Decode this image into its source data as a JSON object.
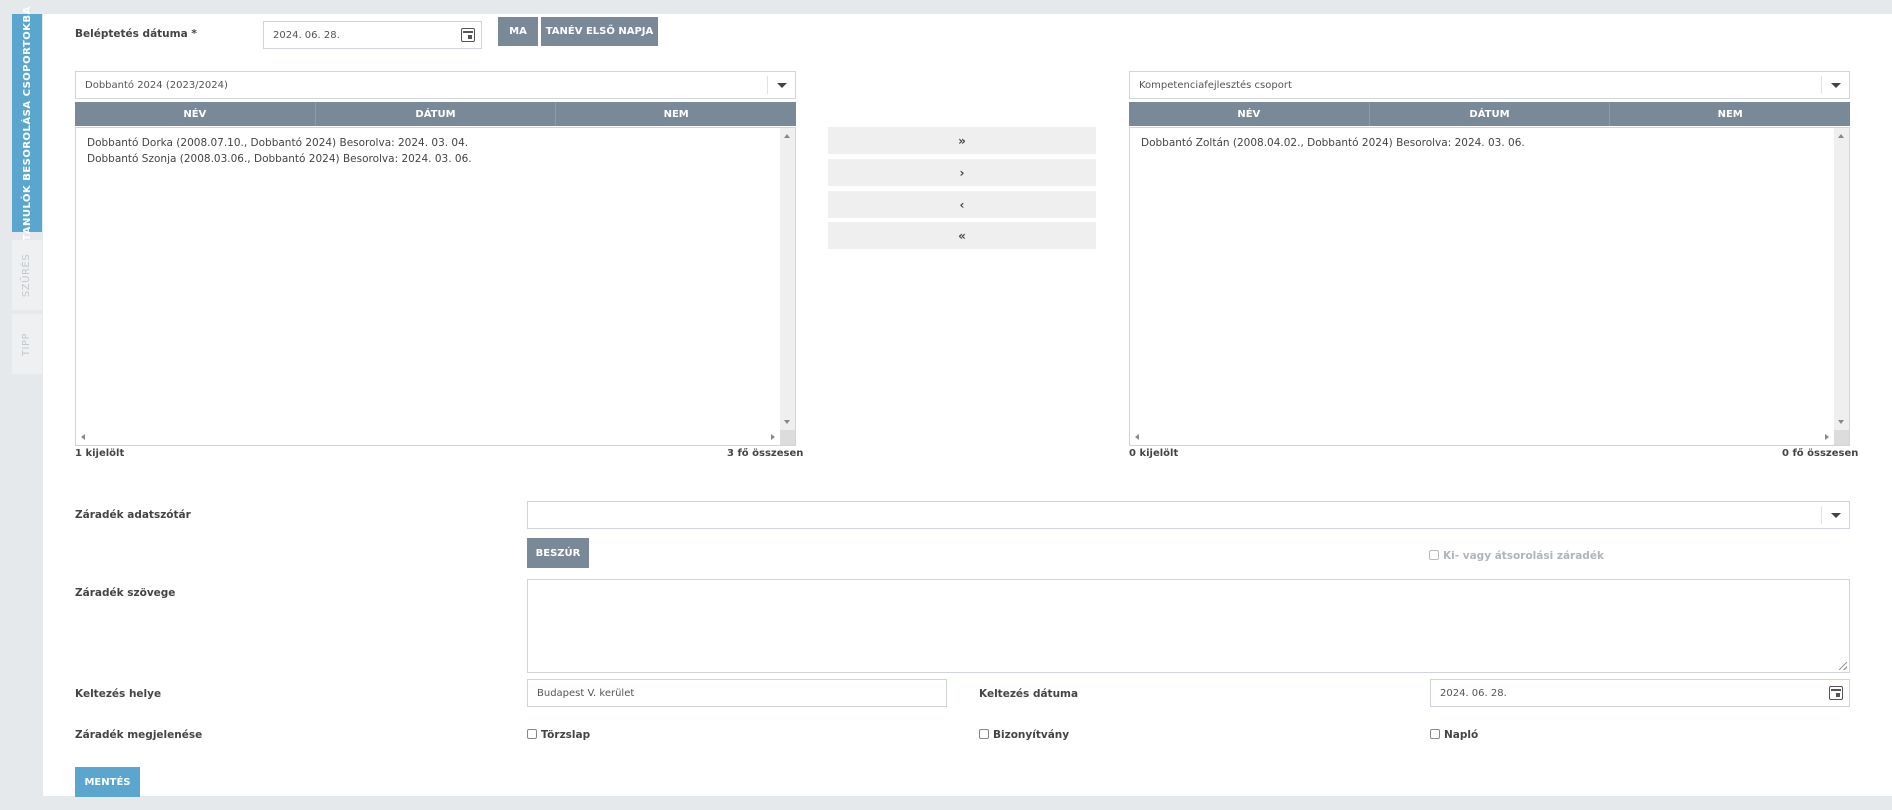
{
  "side_tabs": {
    "active": "TANULÓK BESOROLÁSA CSOPORTOKBA",
    "t2": "SZŰRÉS",
    "t3": "TIPP"
  },
  "promotion_date": {
    "label": "Beléptetés dátuma *",
    "value": "2024. 06. 28.",
    "today_btn": "MA",
    "first_day_btn": "TANÉV ELSŐ NAPJA"
  },
  "left_list": {
    "select_value": "Dobbantó 2024 (2023/2024)",
    "columns": [
      "NÉV",
      "DÁTUM",
      "NEM"
    ],
    "rows": [
      "Dobbantó Dorka (2008.07.10., Dobbantó 2024) Besorolva: 2024. 03. 04.",
      "Dobbantó Szonja (2008.03.06., Dobbantó 2024) Besorolva: 2024. 03. 06."
    ],
    "selected": "1 kijelölt",
    "total": "3 fő összesen"
  },
  "right_list": {
    "select_value": "Kompetenciafejlesztés csoport",
    "columns": [
      "NÉV",
      "DÁTUM",
      "NEM"
    ],
    "rows": [
      "Dobbantó Zoltán (2008.04.02., Dobbantó 2024) Besorolva: 2024. 03. 06."
    ],
    "selected": "0 kijelölt",
    "total": "0 fő összesen"
  },
  "move_buttons": [
    "»",
    "›",
    "‹",
    "«"
  ],
  "clause": {
    "dictionary_label": "Záradék adatszótár",
    "dictionary_value": "",
    "insert_btn": "BESZÚR",
    "exclusion_label": "Ki- vagy átsorolási záradék",
    "text_label": "Záradék szövege",
    "text_value": ""
  },
  "dating": {
    "place_label": "Keltezés helye",
    "place_value": "Budapest V. kerület",
    "date_label": "Keltezés dátuma",
    "date_value": "2024. 06. 28."
  },
  "appearance": {
    "label": "Záradék megjelenése",
    "options": [
      "Törzslap",
      "Bizonyítvány",
      "Napló"
    ]
  },
  "save_btn": "MENTÉS",
  "colors": {
    "accent": "#5aa6cf",
    "header": "#7a8998"
  }
}
